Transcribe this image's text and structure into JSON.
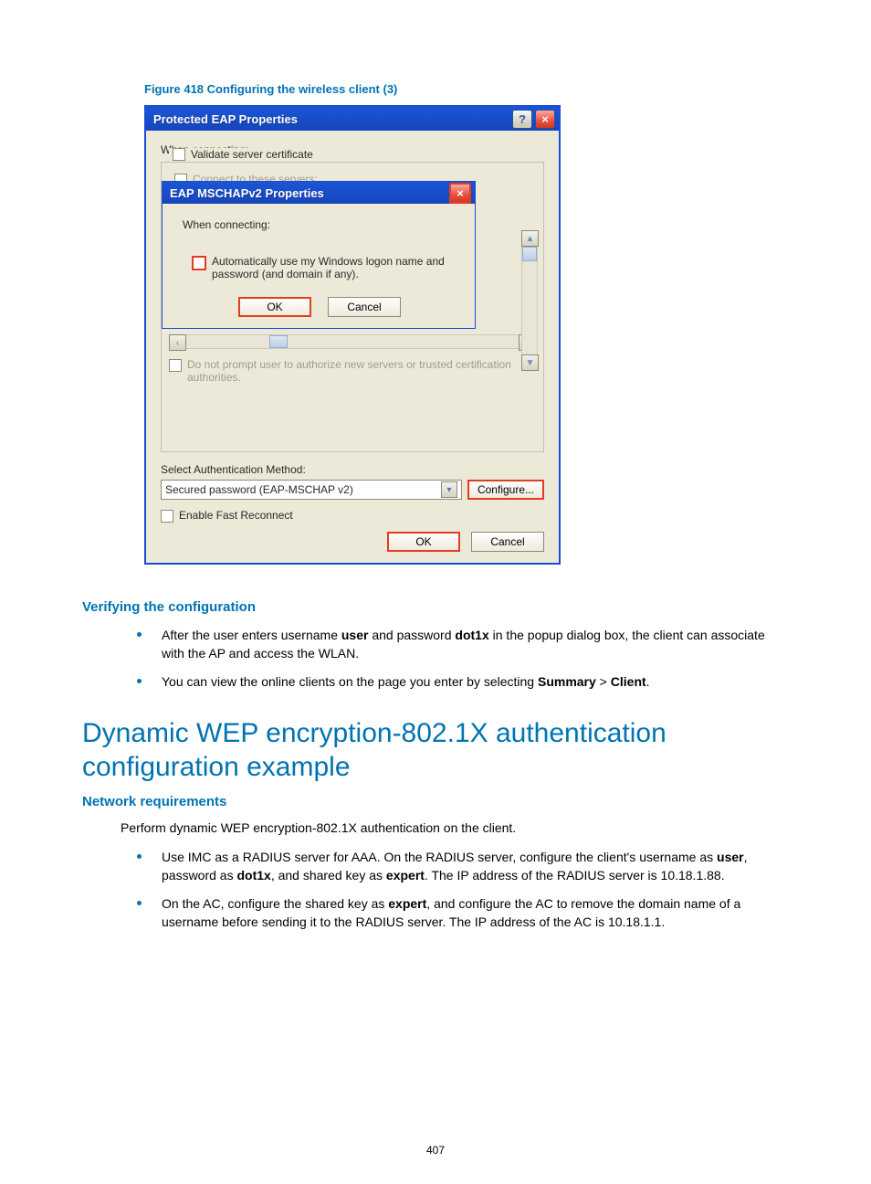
{
  "figure_caption": "Figure 418 Configuring the wireless client (3)",
  "outer_dialog": {
    "title": "Protected EAP Properties",
    "when_connecting": "When connecting:",
    "validate_cert": "Validate server certificate",
    "connect_servers": "Connect to these servers:",
    "no_prompt": "Do not prompt user to authorize new servers or trusted certification authorities.",
    "select_auth_label": "Select Authentication Method:",
    "auth_value": "Secured password (EAP-MSCHAP v2)",
    "configure": "Configure...",
    "fast_reconnect": "Enable Fast Reconnect",
    "ok": "OK",
    "cancel": "Cancel"
  },
  "inner_dialog": {
    "title": "EAP MSCHAPv2 Properties",
    "when_connecting": "When connecting:",
    "auto_logon": "Automatically use my Windows logon name and password (and domain if any).",
    "ok": "OK",
    "cancel": "Cancel"
  },
  "verify": {
    "heading": "Verifying the configuration",
    "b1_pre": "After the user enters username ",
    "b1_user": "user",
    "b1_mid": " and password ",
    "b1_pass": "dot1x",
    "b1_post": " in the popup dialog box, the client can associate with the AP and access the WLAN.",
    "b2_pre": "You can view the online clients on the page you enter by selecting ",
    "b2_summary": "Summary",
    "b2_gt": " > ",
    "b2_client": "Client",
    "b2_end": "."
  },
  "big_heading": "Dynamic WEP encryption-802.1X authentication configuration example",
  "netreq": {
    "heading": "Network requirements",
    "intro": "Perform dynamic WEP encryption-802.1X authentication on the client.",
    "b1_pre": "Use IMC as a RADIUS server for AAA. On the RADIUS server, configure the client's username as ",
    "b1_user": "user",
    "b1_mid1": ", password as ",
    "b1_pass": "dot1x",
    "b1_mid2": ", and shared key as ",
    "b1_key": "expert",
    "b1_post": ". The IP address of the RADIUS server is 10.18.1.88.",
    "b2_pre": "On the AC, configure the shared key as ",
    "b2_key": "expert",
    "b2_post": ", and configure the AC to remove the domain name of a username before sending it to the RADIUS server. The IP address of the AC is 10.18.1.1."
  },
  "page_number": "407"
}
